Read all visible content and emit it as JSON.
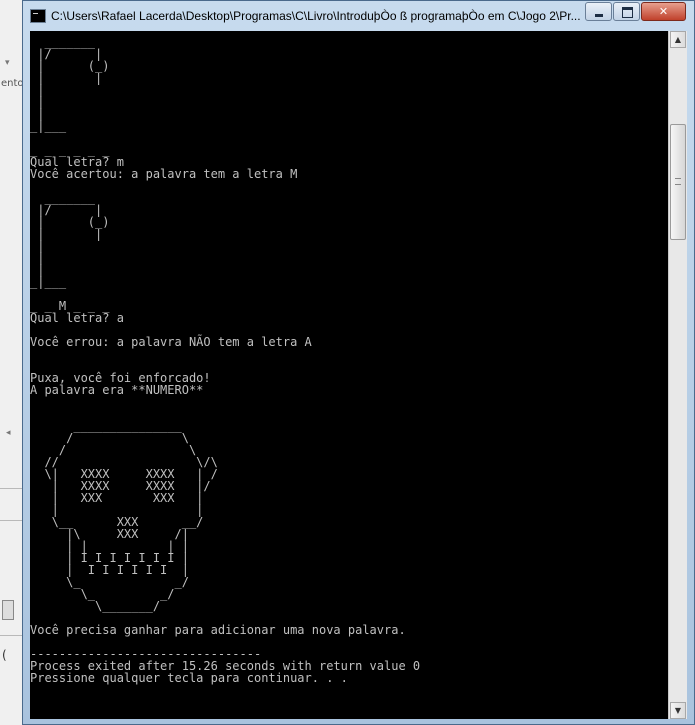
{
  "window": {
    "title": "C:\\Users\\Rafael Lacerda\\Desktop\\Programas\\C\\Livro\\IntroduþÒo ß programaþÒo em C\\Jogo 2\\Pr..."
  },
  "background_app": {
    "label": "ento",
    "paren": "("
  },
  "console": {
    "text": "  _______\n |/      |\n |      (_)\n |       |\n |\n |\n |\n_|___\n\n_ _ _ _ _ _\nQual letra? m\nVocê acertou: a palavra tem a letra M\n\n  _______\n |/      |\n |      (_)\n |       |\n |\n |\n |\n_|___\n\n_ _ M _ _ _\nQual letra? a\n\nVocê errou: a palavra NÃO tem a letra A\n\n\nPuxa, você foi enforcado!\nA palavra era **NUMERO**\n\n\n      _______________\n     /               \\\n    /                 \\\n  //                   \\/\\\n  \\|   XXXX     XXXX   | /\n   |   XXXX     XXXX   |/\n   |   XXX       XXX   |\n   |                   |\n   \\__      XXX      __/\n     |\\     XXX     /|\n     | |           | |\n     | I I I I I I I |\n     |  I I I I I I  |\n     \\_             _/\n       \\_         _/\n         \\_______/\n\nVocê precisa ganhar para adicionar uma nova palavra.\n\n--------------------------------\nProcess exited after 15.26 seconds with return value 0\nPressione qualquer tecla para continuar. . ."
  },
  "colors": {
    "console_bg": "#000000",
    "console_fg": "#c0c0c0",
    "close_button": "#c0412b"
  }
}
